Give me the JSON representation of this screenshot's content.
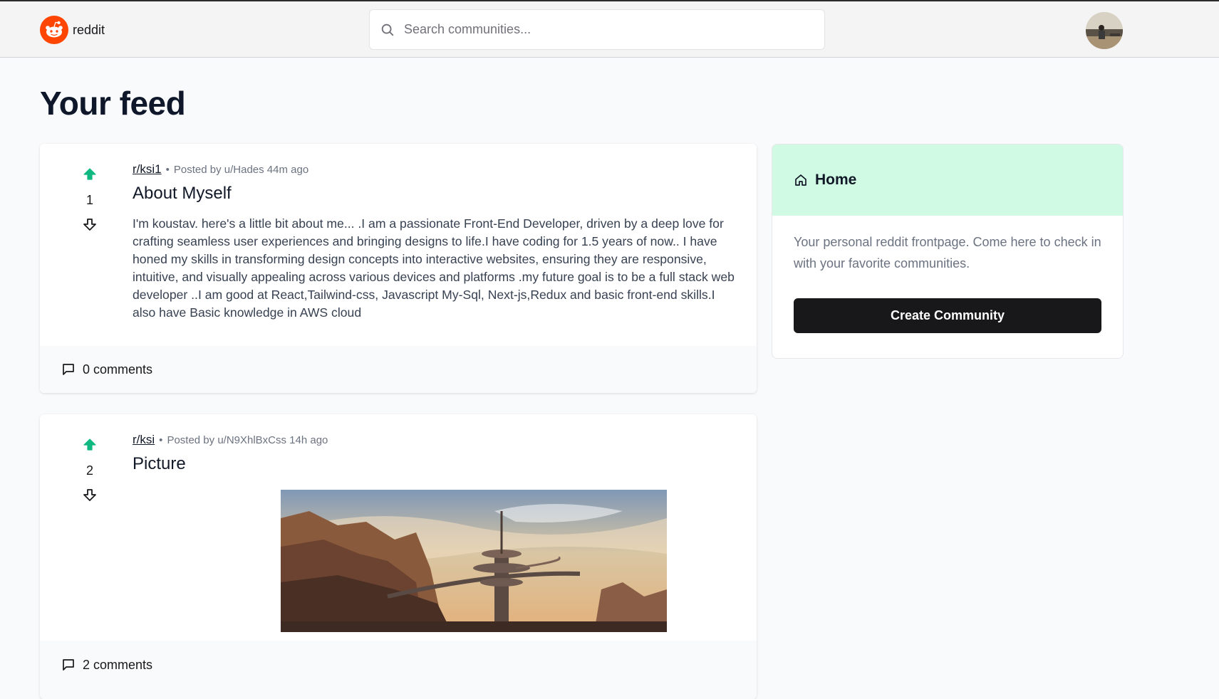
{
  "navbar": {
    "logo_text": "reddit",
    "search": {
      "placeholder": "Search communities..."
    },
    "avatar_icon": "user-avatar"
  },
  "page": {
    "title": "Your feed"
  },
  "posts": [
    {
      "votes": "1",
      "subreddit": "r/ksi1",
      "dot": "•",
      "posted_by": "Posted by u/Hades 44m ago",
      "title": "About Myself",
      "text": "I'm koustav. here's a little bit about me... .I am a passionate Front-End Developer, driven by a deep love for crafting seamless user experiences and bringing designs to life.I have coding for 1.5 years of now.. I have honed my skills in transforming design concepts into interactive websites, ensuring they are responsive, intuitive, and visually appealing across various devices and platforms .my future goal is to be a full stack web developer ..I am good at React,Tailwind-css, Javascript My-Sql, Next-js,Redux and basic front-end skills.I also have Basic knowledge in AWS cloud",
      "comments": "0 comments"
    },
    {
      "votes": "2",
      "subreddit": "r/ksi",
      "dot": "•",
      "posted_by": "Posted by u/N9XhlBxCss 14h ago",
      "title": "Picture",
      "image_icon": "fantasy-city-landscape-image",
      "comments": "2 comments"
    }
  ],
  "sidebar": {
    "title": "Home",
    "description": "Your personal reddit frontpage. Come here to check in with your favorite communities.",
    "create_label": "Create Community"
  },
  "colors": {
    "brand": "#ff4500",
    "upvote": "#10b981",
    "sidebar_header": "#d1fae5",
    "button_dark": "#18181b"
  }
}
